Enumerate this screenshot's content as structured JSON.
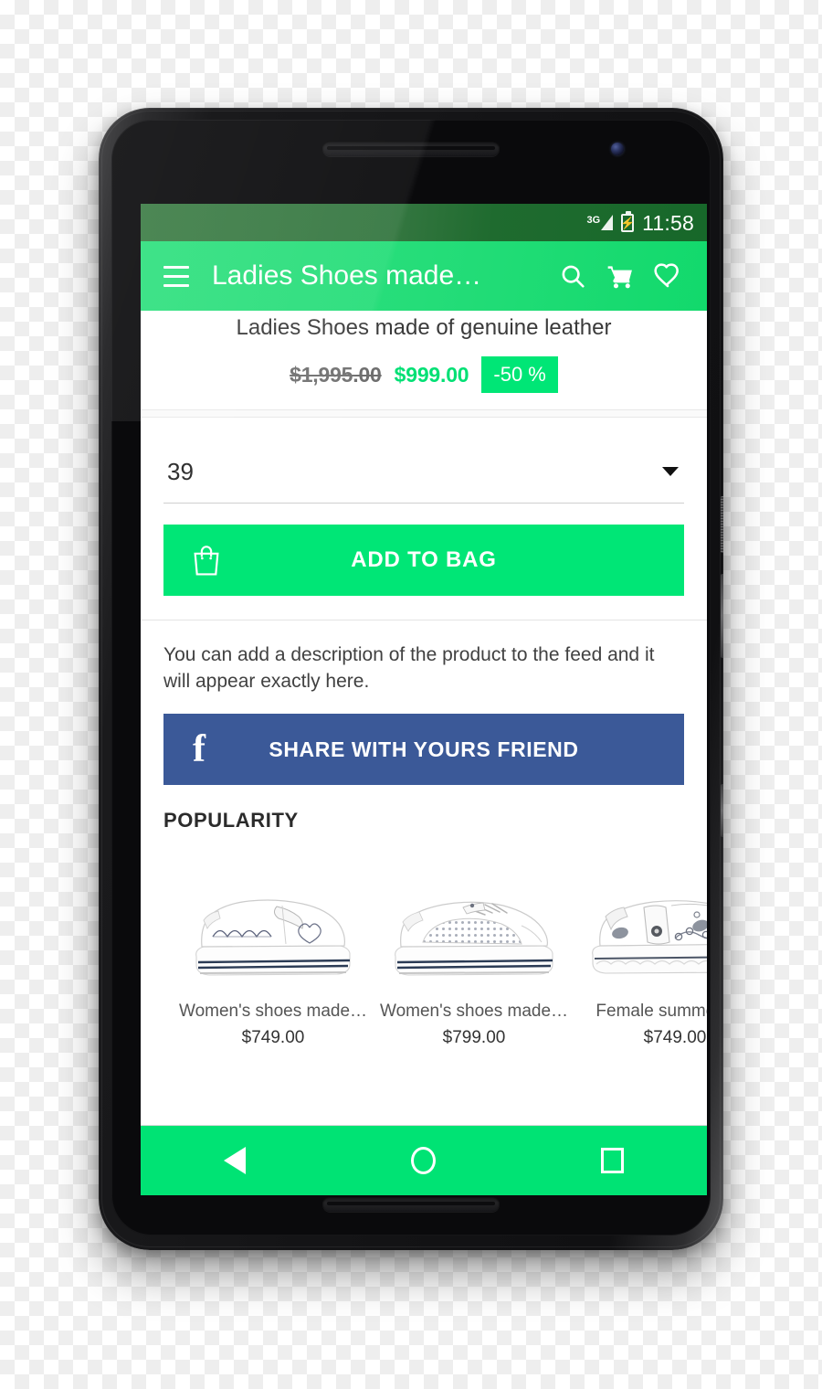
{
  "status_bar": {
    "network_label": "3G",
    "signal_icon": "signal-bars-icon",
    "battery_icon": "battery-charging-icon",
    "time": "11:58"
  },
  "app_bar": {
    "menu_icon": "hamburger-menu-icon",
    "title": "Ladies Shoes made…",
    "search_icon": "search-icon",
    "cart_icon": "shopping-cart-icon",
    "favorite_icon": "heart-outline-icon",
    "background_color": "#25dd79"
  },
  "product": {
    "name": "Ladies Shoes made of genuine leather",
    "old_price": "$1,995.00",
    "new_price": "$999.00",
    "discount_badge": "-50 %",
    "discount_color": "#00e676",
    "price_color": "#00e074"
  },
  "size_selector": {
    "value": "39",
    "dropdown_icon": "chevron-down-icon"
  },
  "add_to_bag": {
    "label": "ADD TO BAG",
    "icon": "shopping-bag-icon",
    "color": "#00e676"
  },
  "description": {
    "text": "You can add a description of the product to the feed and it will appear exactly here."
  },
  "share": {
    "label": "SHARE WITH YOURS FRIEND",
    "icon": "facebook-icon",
    "color": "#3b5998"
  },
  "popularity": {
    "title": "POPULARITY",
    "products": [
      {
        "title": "Women's shoes made…",
        "price": "$749.00",
        "image": "white-platform-slip-on-sneaker"
      },
      {
        "title": "Women's shoes made…",
        "price": "$799.00",
        "image": "white-perforated-platform-sneaker"
      },
      {
        "title": "Female summer sho",
        "price": "$749.00",
        "image": "white-cutout-summer-shoe"
      }
    ]
  },
  "nav_bar": {
    "back_icon": "back-triangle-icon",
    "home_icon": "home-circle-icon",
    "recents_icon": "recents-square-icon",
    "color": "#00e374"
  }
}
